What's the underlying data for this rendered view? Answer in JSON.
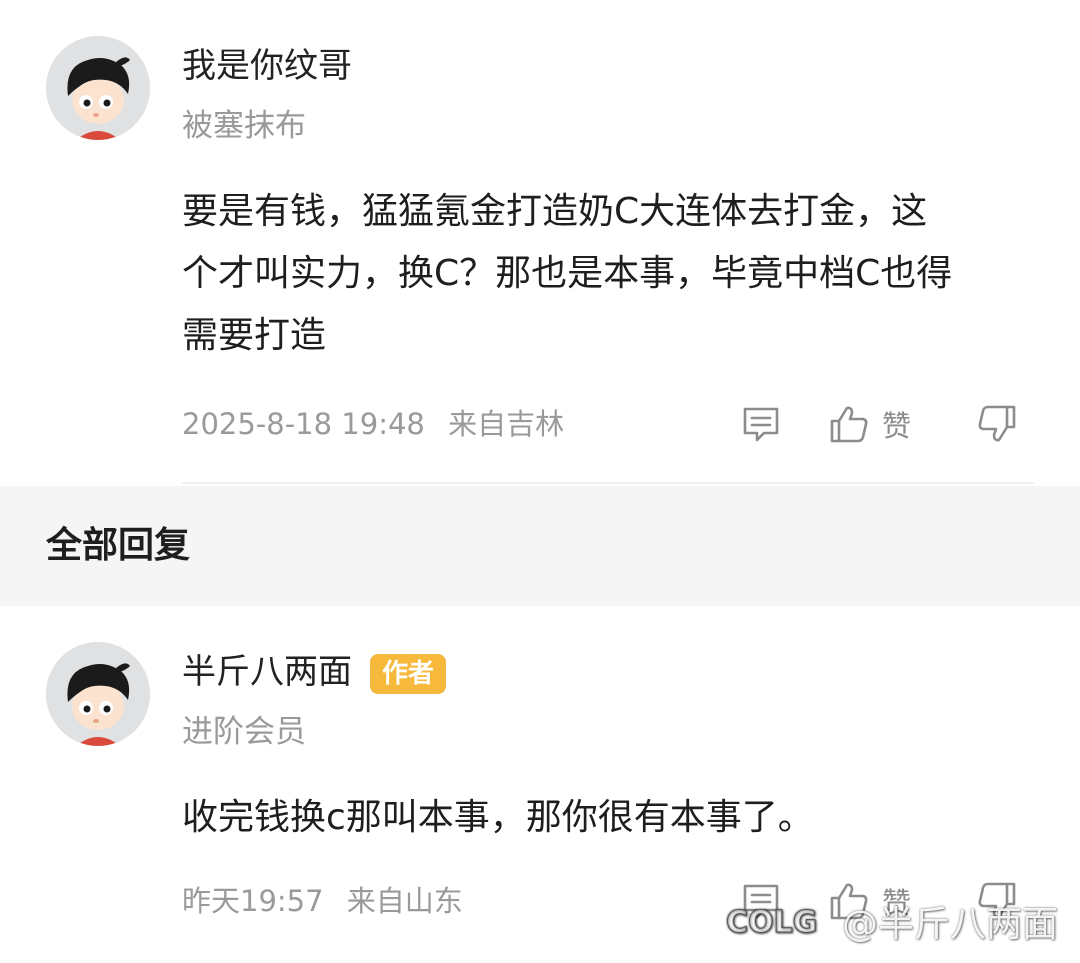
{
  "comment": {
    "username": "我是你纹哥",
    "level": "被塞抹布",
    "text_lines": [
      "要是有钱，猛猛氪金打造奶C大连体去打金，这",
      "个才叫实力，换C？那也是本事，毕竟中档C也得",
      "需要打造"
    ],
    "timestamp": "2025-8-18 19:48",
    "location": "来自吉林",
    "like_label": "赞"
  },
  "section": {
    "title": "全部回复"
  },
  "reply": {
    "username": "半斤八两面",
    "badge": "作者",
    "level": "进阶会员",
    "text": "收完钱换c那叫本事，那你很有本事了。",
    "timestamp": "昨天19:57",
    "location": "来自山东",
    "like_label": "赞"
  },
  "watermark": {
    "logo_text": "COLG",
    "text": "@半斤八两面"
  },
  "icons": {
    "reply": "comment-icon",
    "like": "thumbs-up-icon",
    "dislike": "thumbs-down-icon"
  },
  "colors": {
    "badge": "#f6b93b",
    "secondary_text": "#9a9a9a",
    "section_bg": "#f5f5f5"
  }
}
